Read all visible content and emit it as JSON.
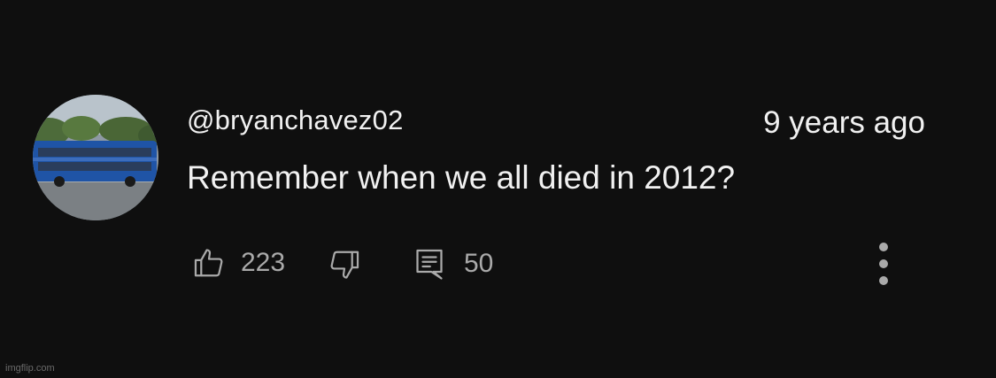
{
  "comment": {
    "username": "@bryanchavez02",
    "timestamp": "9 years ago",
    "text": "Remember when we all died in 2012?",
    "avatar_icon": "bus-photo-avatar"
  },
  "actions": {
    "like_icon": "thumbs-up-icon",
    "like_count": "223",
    "dislike_icon": "thumbs-down-icon",
    "reply_icon": "reply-comment-icon",
    "reply_count": "50",
    "menu_icon": "more-vertical-icon"
  },
  "watermark": "imgflip.com",
  "colors": {
    "background": "#0f0f0f",
    "primary_text": "#f1f1f1",
    "secondary_text": "#aaaaaa"
  }
}
